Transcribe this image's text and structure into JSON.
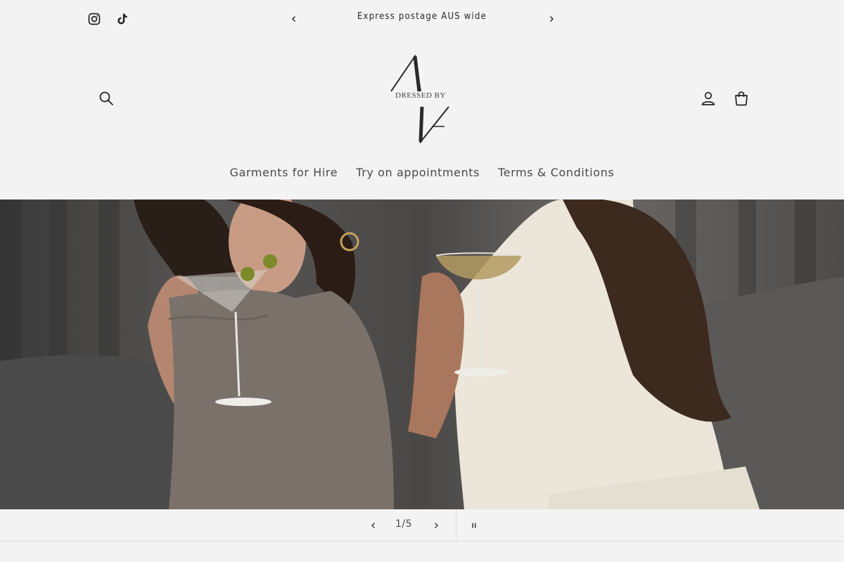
{
  "announcement": {
    "text": "Express postage AUS wide"
  },
  "header": {
    "logo_text": "DRESSED BY"
  },
  "nav": {
    "items": [
      {
        "label": "Garments for Hire"
      },
      {
        "label": "Try on appointments"
      },
      {
        "label": "Terms & Conditions"
      }
    ]
  },
  "slideshow": {
    "counter": "1/5"
  },
  "colors": {
    "background": "#f3f3f3",
    "text": "#121212",
    "muted_text": "#4a4a4a"
  },
  "icons": {
    "social": [
      "instagram-icon",
      "tiktok-icon"
    ],
    "header": [
      "search-icon",
      "account-icon",
      "cart-icon"
    ],
    "controls": [
      "chevron-left-icon",
      "chevron-right-icon",
      "pause-icon"
    ]
  }
}
